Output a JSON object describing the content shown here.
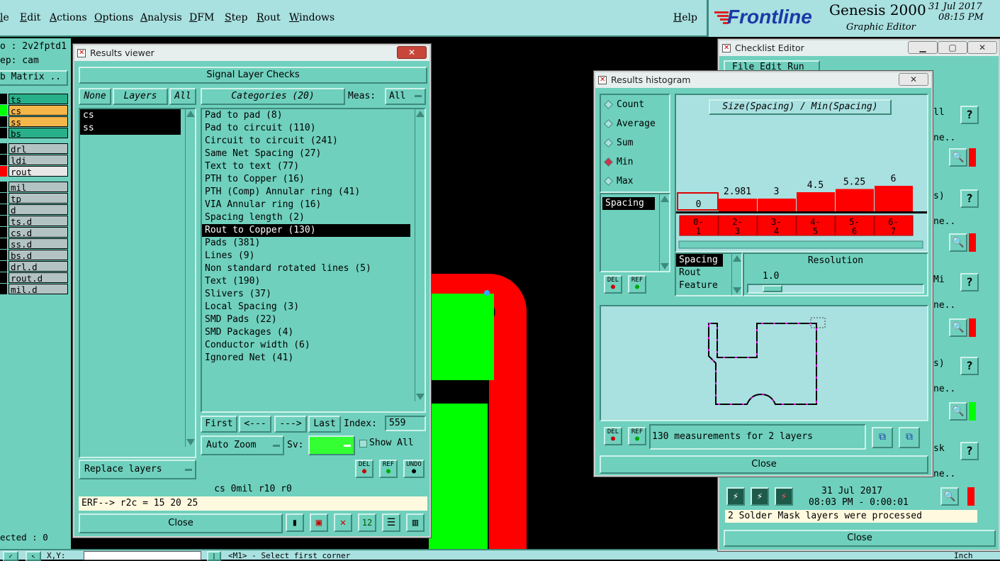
{
  "menubar": {
    "items": [
      "le",
      "Edit",
      "Actions",
      "Options",
      "Analysis",
      "DFM",
      "Step",
      "Rout",
      "Windows"
    ],
    "help": "Help",
    "brand": "Frontline",
    "product": "Genesis 2000",
    "subtitle": "Graphic Editor",
    "date": "31 Jul 2017",
    "time": "08:15 PM"
  },
  "leftpanel": {
    "job": "o : 2v2fptd1",
    "step": "ep: cam",
    "matrix": "b Matrix ..",
    "layers_top": [
      {
        "name": "ts",
        "color": "#28b08a",
        "swatch": "#000"
      },
      {
        "name": "cs",
        "color": "#f5b64a",
        "swatch": "#00ff00"
      },
      {
        "name": "ss",
        "color": "#f5b64a",
        "swatch": "#000"
      },
      {
        "name": "bs",
        "color": "#28b08a",
        "swatch": "#000"
      }
    ],
    "layers_mid": [
      {
        "name": "drl",
        "color": "#b3c3c3",
        "swatch": "#000"
      },
      {
        "name": "ldi",
        "color": "#b3c3c3",
        "swatch": "#000"
      },
      {
        "name": "rout",
        "color": "#e8e8e8",
        "swatch": "#ff0000"
      }
    ],
    "layers_bottom": [
      "mil",
      "tp",
      "d",
      "ts.d",
      "cs.d",
      "ss.d",
      "bs.d",
      "drl.d",
      "rout.d",
      "mil.d"
    ],
    "selected": "ected : 0"
  },
  "results_viewer": {
    "title": "Results viewer",
    "header": "Signal Layer Checks",
    "none": "None",
    "layers": "Layers",
    "all": "All",
    "categories": "Categories (20)",
    "meas_label": "Meas:",
    "meas_value": "All",
    "layer_list": [
      "cs",
      "ss"
    ],
    "category_list": [
      "Pad to pad (8)",
      "Pad to circuit (110)",
      "Circuit to circuit (241)",
      "Same Net Spacing (27)",
      "Text to text (77)",
      "PTH to Copper (16)",
      "PTH (Comp) Annular ring (41)",
      "VIA Annular ring (16)",
      "Spacing length (2)",
      "Rout to Copper (130)",
      "Pads (381)",
      "Lines (9)",
      "Non standard rotated lines (5)",
      "Text (190)",
      "Slivers (37)",
      "Local Spacing (3)",
      "SMD Pads (22)",
      "SMD Packages (4)",
      "Conductor width (6)",
      "Ignored Net (41)"
    ],
    "selected_category": "Rout to Copper (130)",
    "first": "First",
    "prev": "<---",
    "next": "--->",
    "last": "Last",
    "index_label": "Index:",
    "index_value": "559",
    "auto_zoom": "Auto Zoom",
    "sv_label": "Sv:",
    "show_all": "Show All",
    "replace_layers": "Replace layers",
    "del": "DEL",
    "ref": "REF",
    "undo": "UNDO",
    "status": "cs 0mil  r10  r0",
    "erf": "ERF--> r2c = 15 20 25",
    "close": "Close"
  },
  "histogram": {
    "title": "Results histogram",
    "modes": [
      "Count",
      "Average",
      "Sum",
      "Min",
      "Max"
    ],
    "selected_mode": "Min",
    "chart_title": "Size(Spacing) / Min(Spacing)",
    "list_item": "Spacing",
    "bars": [
      {
        "value": "0",
        "range": [
          "0-",
          "1"
        ],
        "level": 0
      },
      {
        "value": "2.981",
        "range": [
          "2-",
          "3"
        ],
        "level": 2.981
      },
      {
        "value": "3",
        "range": [
          "3-",
          "4"
        ],
        "level": 3
      },
      {
        "value": "4.5",
        "range": [
          "4-",
          "5"
        ],
        "level": 4.5
      },
      {
        "value": "5.25",
        "range": [
          "5-",
          "6"
        ],
        "level": 5.25
      },
      {
        "value": "6",
        "range": [
          "6-",
          "7"
        ],
        "level": 6
      }
    ],
    "group_items": [
      "Spacing",
      "Rout",
      "Feature"
    ],
    "resolution_label": "Resolution",
    "resolution_value": "1.0",
    "del": "DEL",
    "ref": "REF",
    "measurements": "130 measurements for 2 layers",
    "close": "Close"
  },
  "checklist": {
    "title": "Checklist Editor",
    "menu": "File  Edit  Run",
    "date": "31 Jul 2017",
    "time": "08:03 PM - 0:00:01",
    "message": "2 Solder Mask layers were processed",
    "close": "Close",
    "fragments": [
      "ll",
      "ne..",
      "s)",
      "ne..",
      "Mi",
      "ne..",
      "s)",
      "ne..",
      "sk",
      "ne.."
    ]
  },
  "bottombar": {
    "xy": "X,Y:",
    "prompt": "<M1> - Select first corner",
    "unit": "Inch"
  }
}
